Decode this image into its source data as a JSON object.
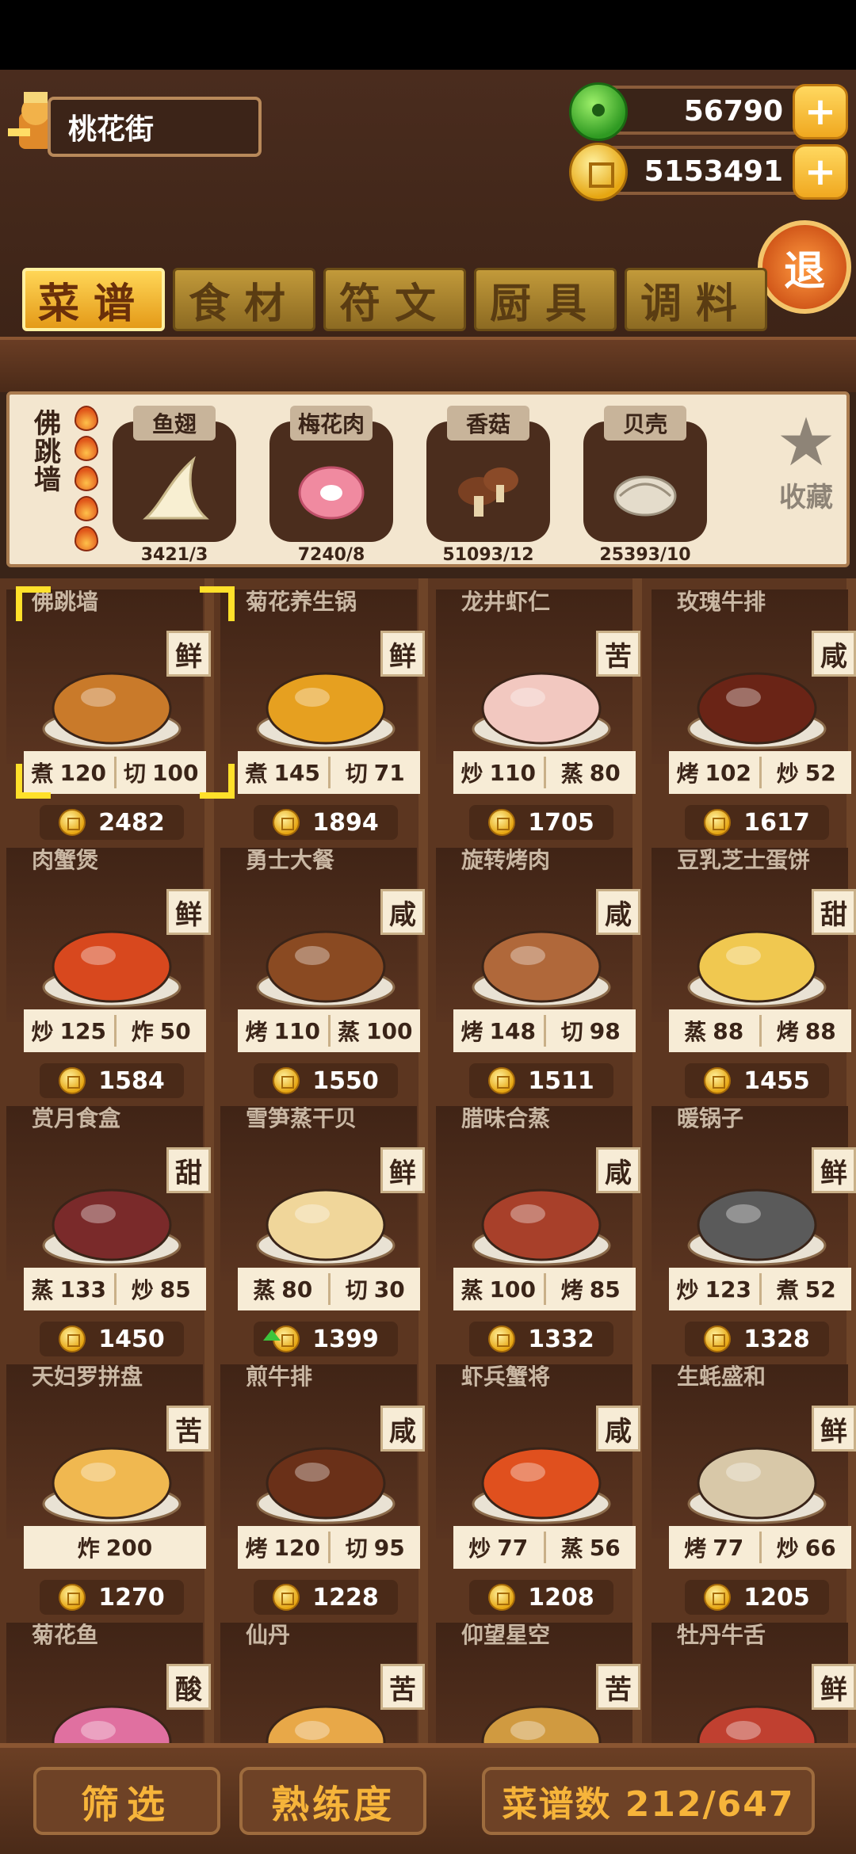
{
  "location": "桃花街",
  "currency": {
    "jade": "56790",
    "coins": "5153491"
  },
  "exit_label": "退",
  "tabs": [
    {
      "label": "菜谱",
      "active": true
    },
    {
      "label": "食材",
      "active": false
    },
    {
      "label": "符文",
      "active": false
    },
    {
      "label": "厨具",
      "active": false
    },
    {
      "label": "调料",
      "active": false
    }
  ],
  "selected": {
    "name": "佛跳墙",
    "flames": 5,
    "ingredients": [
      {
        "name": "鱼翅",
        "count": "3421/3",
        "icon": "shark-fin-icon"
      },
      {
        "name": "梅花肉",
        "count": "7240/8",
        "icon": "pork-icon"
      },
      {
        "name": "香菇",
        "count": "51093/12",
        "icon": "mushroom-icon"
      },
      {
        "name": "贝壳",
        "count": "25393/10",
        "icon": "shell-icon"
      }
    ],
    "favorite_label": "收藏"
  },
  "recipes": [
    {
      "name": "佛跳墙",
      "flavor": "鲜",
      "stats": [
        [
          "煮",
          "120"
        ],
        [
          "切",
          "100"
        ]
      ],
      "price": "2482",
      "color": "#c97a2a"
    },
    {
      "name": "菊花养生锅",
      "flavor": "鲜",
      "stats": [
        [
          "煮",
          "145"
        ],
        [
          "切",
          "71"
        ]
      ],
      "price": "1894",
      "color": "#e6a020"
    },
    {
      "name": "龙井虾仁",
      "flavor": "苦",
      "stats": [
        [
          "炒",
          "110"
        ],
        [
          "蒸",
          "80"
        ]
      ],
      "price": "1705",
      "color": "#f2c8c0"
    },
    {
      "name": "玫瑰牛排",
      "flavor": "咸",
      "stats": [
        [
          "烤",
          "102"
        ],
        [
          "炒",
          "52"
        ]
      ],
      "price": "1617",
      "color": "#6a2416"
    },
    {
      "name": "肉蟹煲",
      "flavor": "鲜",
      "stats": [
        [
          "炒",
          "125"
        ],
        [
          "炸",
          "50"
        ]
      ],
      "price": "1584",
      "color": "#d8481e"
    },
    {
      "name": "勇士大餐",
      "flavor": "咸",
      "stats": [
        [
          "烤",
          "110"
        ],
        [
          "蒸",
          "100"
        ]
      ],
      "price": "1550",
      "color": "#8a4a22"
    },
    {
      "name": "旋转烤肉",
      "flavor": "咸",
      "stats": [
        [
          "烤",
          "148"
        ],
        [
          "切",
          "98"
        ]
      ],
      "price": "1511",
      "color": "#b0683a"
    },
    {
      "name": "豆乳芝士蛋饼",
      "flavor": "甜",
      "stats": [
        [
          "蒸",
          "88"
        ],
        [
          "烤",
          "88"
        ]
      ],
      "price": "1455",
      "color": "#f0c850"
    },
    {
      "name": "赏月食盒",
      "flavor": "甜",
      "stats": [
        [
          "蒸",
          "133"
        ],
        [
          "炒",
          "85"
        ]
      ],
      "price": "1450",
      "color": "#7a2a2a"
    },
    {
      "name": "雪笋蒸干贝",
      "flavor": "鲜",
      "stats": [
        [
          "蒸",
          "80"
        ],
        [
          "切",
          "30"
        ]
      ],
      "price": "1399",
      "color": "#f0d69a",
      "up": true
    },
    {
      "name": "腊味合蒸",
      "flavor": "咸",
      "stats": [
        [
          "蒸",
          "100"
        ],
        [
          "烤",
          "85"
        ]
      ],
      "price": "1332",
      "color": "#a8402a"
    },
    {
      "name": "暖锅子",
      "flavor": "鲜",
      "stats": [
        [
          "炒",
          "123"
        ],
        [
          "煮",
          "52"
        ]
      ],
      "price": "1328",
      "color": "#5a5a5a"
    },
    {
      "name": "天妇罗拼盘",
      "flavor": "苦",
      "stats": [
        [
          "炸",
          "200"
        ]
      ],
      "price": "1270",
      "color": "#f0b850"
    },
    {
      "name": "煎牛排",
      "flavor": "咸",
      "stats": [
        [
          "烤",
          "120"
        ],
        [
          "切",
          "95"
        ]
      ],
      "price": "1228",
      "color": "#6a3018"
    },
    {
      "name": "虾兵蟹将",
      "flavor": "咸",
      "stats": [
        [
          "炒",
          "77"
        ],
        [
          "蒸",
          "56"
        ]
      ],
      "price": "1208",
      "color": "#e0501e"
    },
    {
      "name": "生蚝盛和",
      "flavor": "鲜",
      "stats": [
        [
          "烤",
          "77"
        ],
        [
          "炒",
          "66"
        ]
      ],
      "price": "1205",
      "color": "#d8c8a8"
    },
    {
      "name": "菊花鱼",
      "flavor": "酸",
      "stats": [],
      "price": "",
      "color": "#e070a0"
    },
    {
      "name": "仙丹",
      "flavor": "苦",
      "stats": [],
      "price": "",
      "color": "#e8a848"
    },
    {
      "name": "仰望星空",
      "flavor": "苦",
      "stats": [],
      "price": "",
      "color": "#d09a40"
    },
    {
      "name": "牡丹牛舌",
      "flavor": "鲜",
      "stats": [],
      "price": "",
      "color": "#c04030"
    }
  ],
  "bottom": {
    "filter_label": "筛选",
    "proficiency_label": "熟练度",
    "recipe_count": "菜谱数 212/647"
  }
}
